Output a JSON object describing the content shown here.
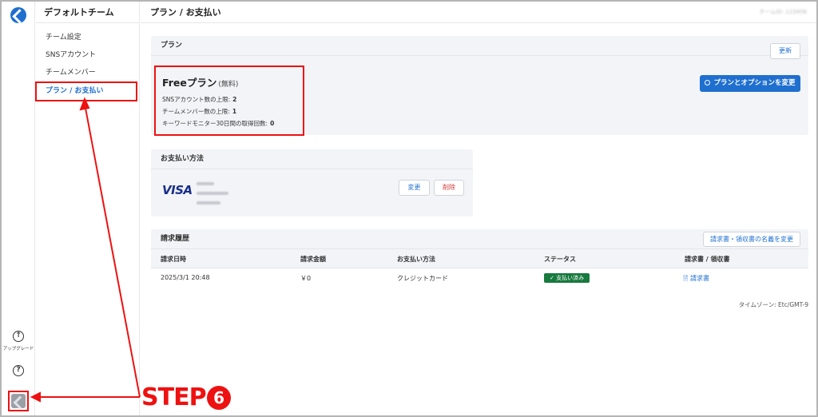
{
  "rail": {
    "upgrade_label": "アップグレード",
    "upgrade_icon": "arrow-up-circle-icon",
    "help_icon": "question-circle-icon",
    "help_glyph": "?",
    "upgrade_glyph": "↑"
  },
  "sidebar": {
    "team_name": "デフォルトチーム",
    "items": [
      {
        "label": "チーム設定"
      },
      {
        "label": "SNSアカウント"
      },
      {
        "label": "チームメンバー"
      },
      {
        "label": "プラン / お支払い",
        "active": true
      }
    ]
  },
  "header": {
    "title": "プラン / お支払い",
    "account_id": "チームID: 123456"
  },
  "plan": {
    "heading": "プラン",
    "update_button": "更新",
    "name": "Freeプラン",
    "name_suffix": "(無料)",
    "lines": [
      {
        "label": "SNSアカウント数の上限:",
        "value": "2"
      },
      {
        "label": "チームメンバー数の上限:",
        "value": "1"
      },
      {
        "label": "キーワードモニター30日間の取得回数:",
        "value": "0"
      }
    ],
    "change_button": "プランとオプションを変更",
    "change_icon": "arrow-circle-icon"
  },
  "payment": {
    "heading": "お支払い方法",
    "card_brand": "VISA",
    "change_button": "変更",
    "delete_button": "削除"
  },
  "history": {
    "heading": "請求履歴",
    "rename_button": "請求書・領収書の名義を変更",
    "columns": [
      "請求日時",
      "請求金額",
      "お支払い方法",
      "ステータス",
      "請求書 / 領収書"
    ],
    "rows": [
      {
        "date": "2025/3/1 20:48",
        "amount": "￥0",
        "method": "クレジットカード",
        "status": "支払い済み",
        "invoice": "請求書"
      }
    ]
  },
  "timezone": "タイムゾーン: Etc/GMT-9",
  "annotation": {
    "step_text": "STEP",
    "step_number": "6",
    "color": "#ee1111"
  },
  "colors": {
    "accent": "#1f6fcf",
    "paid_badge": "#177a3e",
    "delete": "#d23b3b"
  }
}
